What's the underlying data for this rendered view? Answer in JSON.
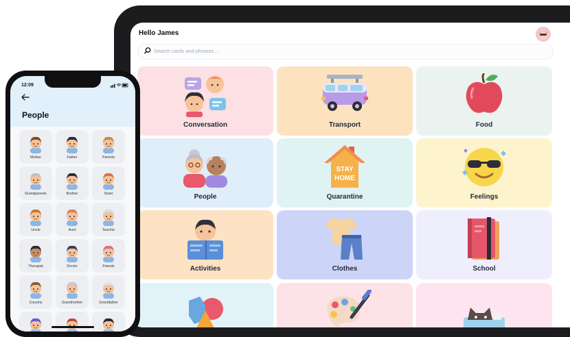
{
  "tablet": {
    "greeting": "Hello James",
    "search_placeholder": "Search cards and phrases...",
    "tiles": [
      {
        "label": "Conversation",
        "bg": "#fde0e3",
        "icon": "conversation-icon"
      },
      {
        "label": "Transport",
        "bg": "#fde2bf",
        "icon": "van-icon"
      },
      {
        "label": "Food",
        "bg": "#eaf3ef",
        "icon": "apple-icon"
      },
      {
        "label": "People",
        "bg": "#e0eef9",
        "icon": "grandparents-icon"
      },
      {
        "label": "Quarantine",
        "bg": "#e0f3f3",
        "icon": "stay-home-icon"
      },
      {
        "label": "Feelings",
        "bg": "#fdf3cd",
        "icon": "sunglasses-emoji-icon"
      },
      {
        "label": "Activities",
        "bg": "#fde2c4",
        "icon": "reading-kid-icon"
      },
      {
        "label": "Clothes",
        "bg": "#ccd5f7",
        "icon": "clothes-icon"
      },
      {
        "label": "School",
        "bg": "#efeefd",
        "icon": "notebook-icon"
      },
      {
        "label": "",
        "bg": "#e1f3f8",
        "icon": "shapes-icon"
      },
      {
        "label": "",
        "bg": "#fde2e8",
        "icon": "paint-palette-icon"
      },
      {
        "label": "",
        "bg": "#fde4ef",
        "icon": "cat-icon"
      }
    ]
  },
  "phone": {
    "time": "12:09",
    "title": "People",
    "cards": [
      {
        "label": "Mother",
        "hair": "#7a4b2a",
        "skin": "#f3c29a"
      },
      {
        "label": "Father",
        "hair": "#2b2b36",
        "skin": "#f3c29a"
      },
      {
        "label": "Parents",
        "hair": "#c98a3c",
        "skin": "#f3c29a"
      },
      {
        "label": "Grandparents",
        "hair": "#bfbfc7",
        "skin": "#f3c29a"
      },
      {
        "label": "Brother",
        "hair": "#2b2b36",
        "skin": "#f3c29a"
      },
      {
        "label": "Sister",
        "hair": "#d9743a",
        "skin": "#f3c29a"
      },
      {
        "label": "Uncle",
        "hair": "#c7772f",
        "skin": "#f3c29a"
      },
      {
        "label": "Aunt",
        "hair": "#e07a63",
        "skin": "#f3c29a"
      },
      {
        "label": "Teacher",
        "hair": "#d9d9df",
        "skin": "#f3c29a"
      },
      {
        "label": "Therapist",
        "hair": "#2b2b36",
        "skin": "#c98f6a"
      },
      {
        "label": "Doctor",
        "hair": "#3a3a52",
        "skin": "#f3c29a"
      },
      {
        "label": "Friends",
        "hair": "#e06b8f",
        "skin": "#f3c29a"
      },
      {
        "label": "Cousins",
        "hair": "#8a5a2a",
        "skin": "#f3c29a"
      },
      {
        "label": "Grandmother",
        "hair": "#c8c8d0",
        "skin": "#f3c29a"
      },
      {
        "label": "Grandfather",
        "hair": "#e3e3e8",
        "skin": "#f3c29a"
      },
      {
        "label": "",
        "hair": "#6a5acd",
        "skin": "#f3c29a"
      },
      {
        "label": "",
        "hair": "#b5533b",
        "skin": "#f3c29a"
      },
      {
        "label": "",
        "hair": "#2b2b36",
        "skin": "#f3c29a"
      }
    ]
  }
}
